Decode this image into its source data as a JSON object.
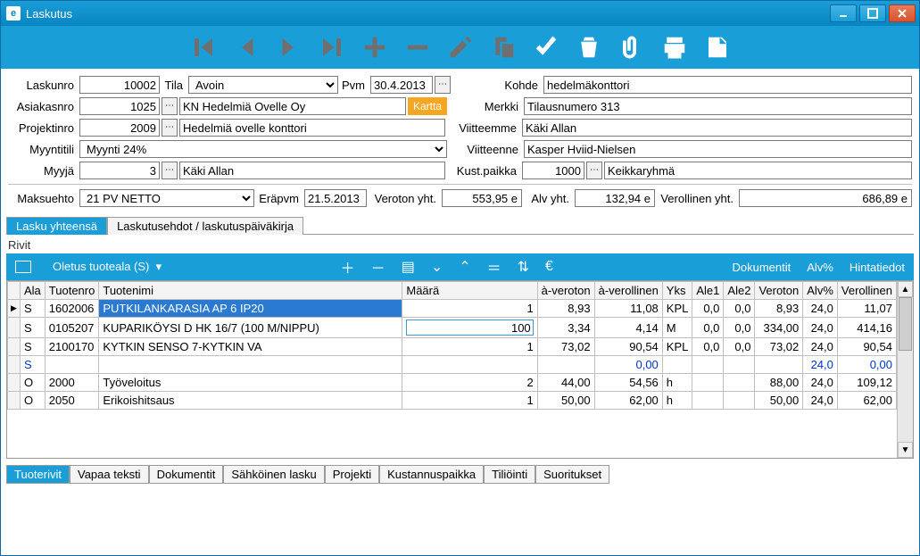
{
  "window": {
    "title": "Laskutus"
  },
  "fields": {
    "laskunro_lbl": "Laskunro",
    "laskunro": "10002",
    "tila_lbl": "Tila",
    "tila": "Avoin",
    "pvm_lbl": "Pvm",
    "pvm": "30.4.2013",
    "kohde_lbl": "Kohde",
    "kohde": "hedelmäkonttori",
    "asiakasnro_lbl": "Asiakasnro",
    "asiakasnro": "1025",
    "asiakas_name": "KN Hedelmiä Ovelle Oy",
    "kartta_btn": "Kartta",
    "merkki_lbl": "Merkki",
    "merkki": "Tilausnumero 313",
    "projektinro_lbl": "Projektinro",
    "projektinro": "2009",
    "projekti_name": "Hedelmiä ovelle konttori",
    "viitteemme_lbl": "Viitteemme",
    "viitteemme": "Käki Allan",
    "myyntitili_lbl": "Myyntitili",
    "myyntitili": "Myynti 24%",
    "viitteenne_lbl": "Viitteenne",
    "viitteenne": "Kasper Hviid-Nielsen",
    "myyja_lbl": "Myyjä",
    "myyja_nro": "3",
    "myyja_name": "Käki Allan",
    "kustpaikka_lbl": "Kust.paikka",
    "kustpaikka_nro": "1000",
    "kustpaikka_name": "Keikkaryhmä",
    "maksuehto_lbl": "Maksuehto",
    "maksuehto": "21 PV NETTO",
    "erapvm_lbl": "Eräpvm",
    "erapvm": "21.5.2013",
    "verotonyht_lbl": "Veroton yht.",
    "verotonyht": "553,95 e",
    "alvyht_lbl": "Alv yht.",
    "alvyht": "132,94 e",
    "verollinenyht_lbl": "Verollinen yht.",
    "verollinenyht": "686,89 e"
  },
  "top_tabs": {
    "a": "Lasku yhteensä",
    "b": "Laskutusehdot / laskutuspäiväkirja"
  },
  "rows_section": "Rivit",
  "rows_toolbar": {
    "oletus": "Oletus tuoteala (S)",
    "dokumentit": "Dokumentit",
    "alv": "Alv%",
    "hintatiedot": "Hintatiedot"
  },
  "columns": {
    "ala": "Ala",
    "tuotenro": "Tuotenro",
    "tuotenimi": "Tuotenimi",
    "maara": "Määrä",
    "averoton": "à-veroton",
    "averollinen": "à-verollinen",
    "yks": "Yks",
    "ale1": "Ale1",
    "ale2": "Ale2",
    "veroton": "Veroton",
    "alv": "Alv%",
    "verollinen": "Verollinen"
  },
  "rows": [
    {
      "ala": "S",
      "tuotenro": "1602006",
      "tuotenimi": "PUTKILANKARASIA AP 6 IP20",
      "maara": "1",
      "averoton": "8,93",
      "averollinen": "11,08",
      "yks": "KPL",
      "ale1": "0,0",
      "ale2": "0,0",
      "veroton": "8,93",
      "alv": "24,0",
      "verollinen": "11,07"
    },
    {
      "ala": "S",
      "tuotenro": "0105207",
      "tuotenimi": "KUPARIKÖYSI D HK 16/7 (100 M/NIPPU)",
      "maara": "100",
      "averoton": "3,34",
      "averollinen": "4,14",
      "yks": "M",
      "ale1": "0,0",
      "ale2": "0,0",
      "veroton": "334,00",
      "alv": "24,0",
      "verollinen": "414,16"
    },
    {
      "ala": "S",
      "tuotenro": "2100170",
      "tuotenimi": "KYTKIN SENSO 7-KYTKIN VA",
      "maara": "1",
      "averoton": "73,02",
      "averollinen": "90,54",
      "yks": "KPL",
      "ale1": "0,0",
      "ale2": "0,0",
      "veroton": "73,02",
      "alv": "24,0",
      "verollinen": "90,54"
    },
    {
      "ala": "S",
      "tuotenro": "",
      "tuotenimi": "",
      "maara": "",
      "averoton": "",
      "averollinen": "0,00",
      "yks": "",
      "ale1": "",
      "ale2": "",
      "veroton": "",
      "alv": "24,0",
      "verollinen": "0,00"
    },
    {
      "ala": "O",
      "tuotenro": "2000",
      "tuotenimi": "Työveloitus",
      "maara": "2",
      "averoton": "44,00",
      "averollinen": "54,56",
      "yks": "h",
      "ale1": "",
      "ale2": "",
      "veroton": "88,00",
      "alv": "24,0",
      "verollinen": "109,12"
    },
    {
      "ala": "O",
      "tuotenro": "2050",
      "tuotenimi": "Erikoishitsaus",
      "maara": "1",
      "averoton": "50,00",
      "averollinen": "62,00",
      "yks": "h",
      "ale1": "",
      "ale2": "",
      "veroton": "50,00",
      "alv": "24,0",
      "verollinen": "62,00"
    }
  ],
  "edit_row_index": 1,
  "bottom_tabs": {
    "a": "Tuoterivit",
    "b": "Vapaa teksti",
    "c": "Dokumentit",
    "d": "Sähköinen lasku",
    "e": "Projekti",
    "f": "Kustannuspaikka",
    "g": "Tiliöinti",
    "h": "Suoritukset"
  }
}
